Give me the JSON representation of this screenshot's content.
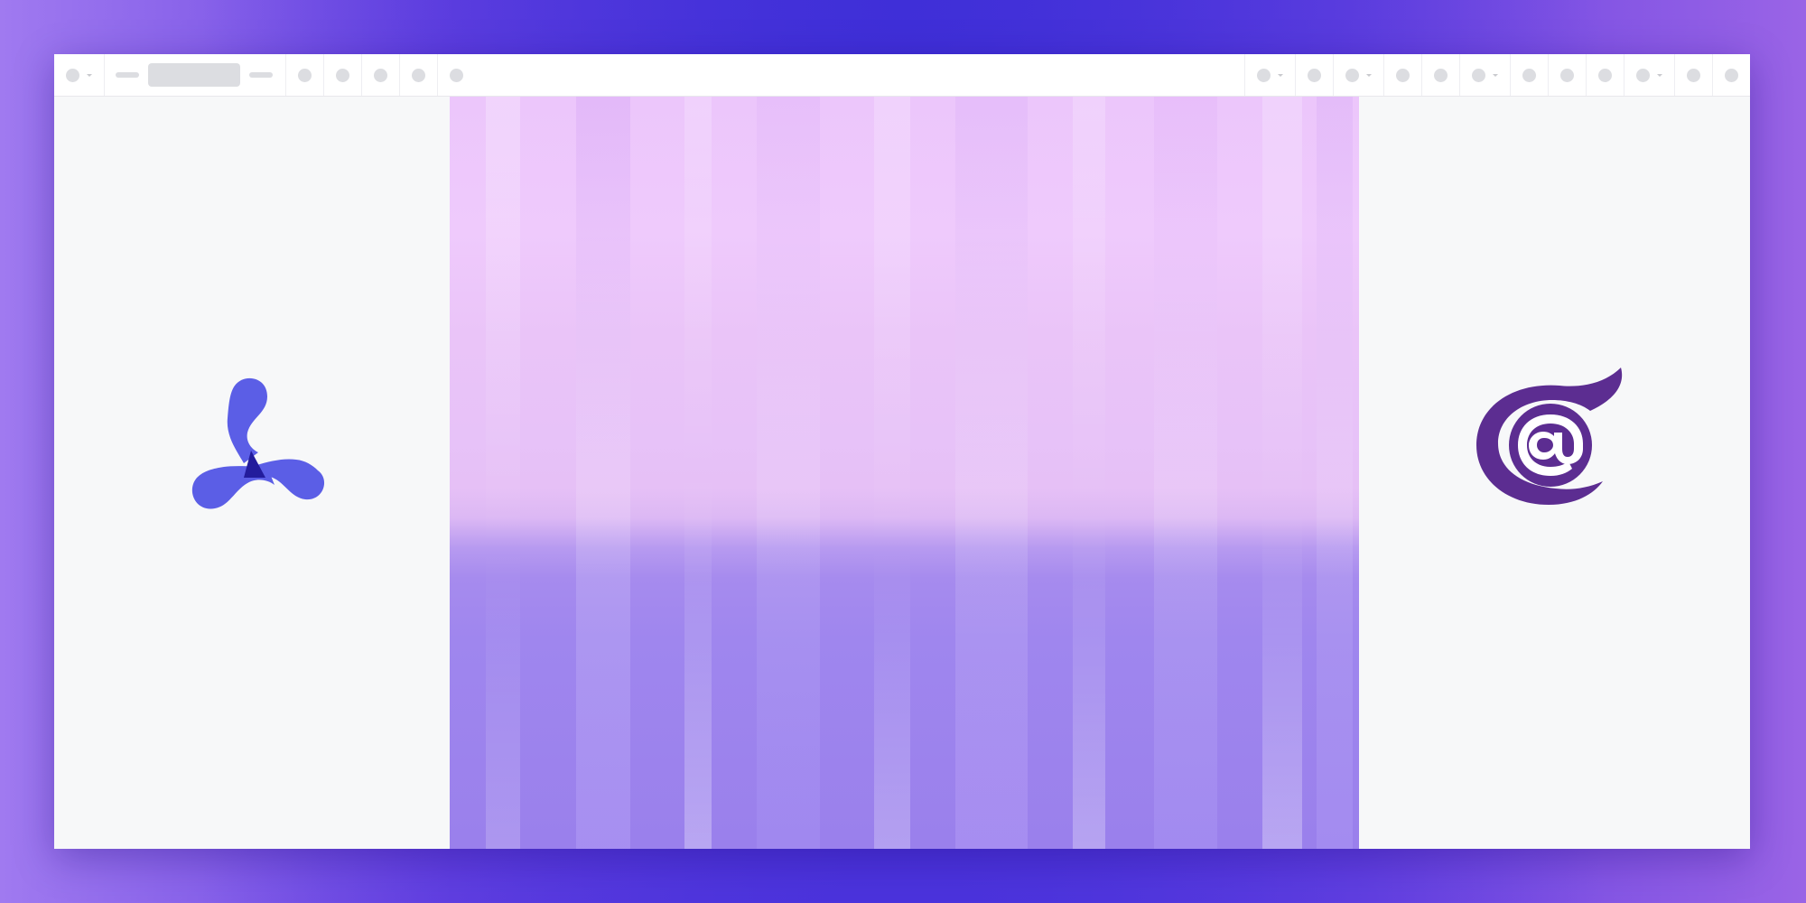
{
  "background": {
    "gradient_colors": [
      "#a07af0",
      "#4a34dc",
      "#9a64e6"
    ]
  },
  "window": {
    "toolbar": {
      "left_icons": [
        "toolbar-icon-1",
        "zoom-control",
        "toolbar-icon-2",
        "toolbar-icon-3",
        "toolbar-icon-4",
        "toolbar-icon-5",
        "toolbar-icon-6"
      ],
      "right_icons": [
        "toolbar-icon-r1",
        "toolbar-icon-r2",
        "toolbar-icon-r3",
        "toolbar-icon-r4",
        "toolbar-icon-r5",
        "toolbar-icon-r6",
        "toolbar-icon-r7",
        "toolbar-icon-r8",
        "toolbar-icon-r9",
        "toolbar-icon-r10",
        "toolbar-icon-r11",
        "toolbar-icon-r12"
      ]
    },
    "left_logo": {
      "icon": "pspdfkit-logo-icon",
      "color": "#5b5ee6",
      "accent": "#1f1a99"
    },
    "right_logo": {
      "icon": "blazor-logo-icon",
      "color": "#5c2d91"
    },
    "canvas": {
      "image": "purple-paint-texture",
      "colors": [
        "#ecc6fb",
        "#9a80ec"
      ]
    }
  }
}
